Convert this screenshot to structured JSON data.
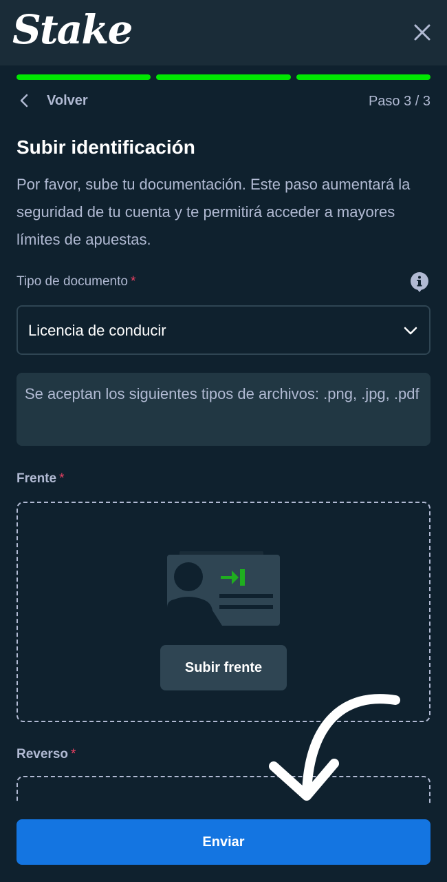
{
  "header": {
    "brand": "Stake"
  },
  "progress": {
    "steps_total": 3,
    "steps_done": 3,
    "color": "#00e701"
  },
  "nav": {
    "back_label": "Volver",
    "step_label": "Paso 3 / 3"
  },
  "form": {
    "title": "Subir identificación",
    "description": "Por favor, sube tu documentación. Este paso aumentará la seguridad de tu cuenta y te permitirá acceder a mayores límites de apuestas.",
    "doc_type_label": "Tipo de documento",
    "required_mark": "*",
    "doc_type_value": "Licencia de conducir",
    "file_types_note": "Se aceptan los siguientes tipos de archivos: .png, .jpg, .pdf",
    "front_label": "Frente",
    "front_button": "Subir frente",
    "back_label": "Reverso",
    "submit_label": "Enviar"
  },
  "colors": {
    "background": "#0f212e",
    "header": "#1a2c38",
    "muted_text": "#b1bad3",
    "required": "#ed4163",
    "primary_button": "#1475e1"
  },
  "icons": [
    "close-icon",
    "chevron-left-icon",
    "info-icon",
    "chevron-down-icon",
    "id-card-upload-icon",
    "curved-arrow-icon"
  ]
}
